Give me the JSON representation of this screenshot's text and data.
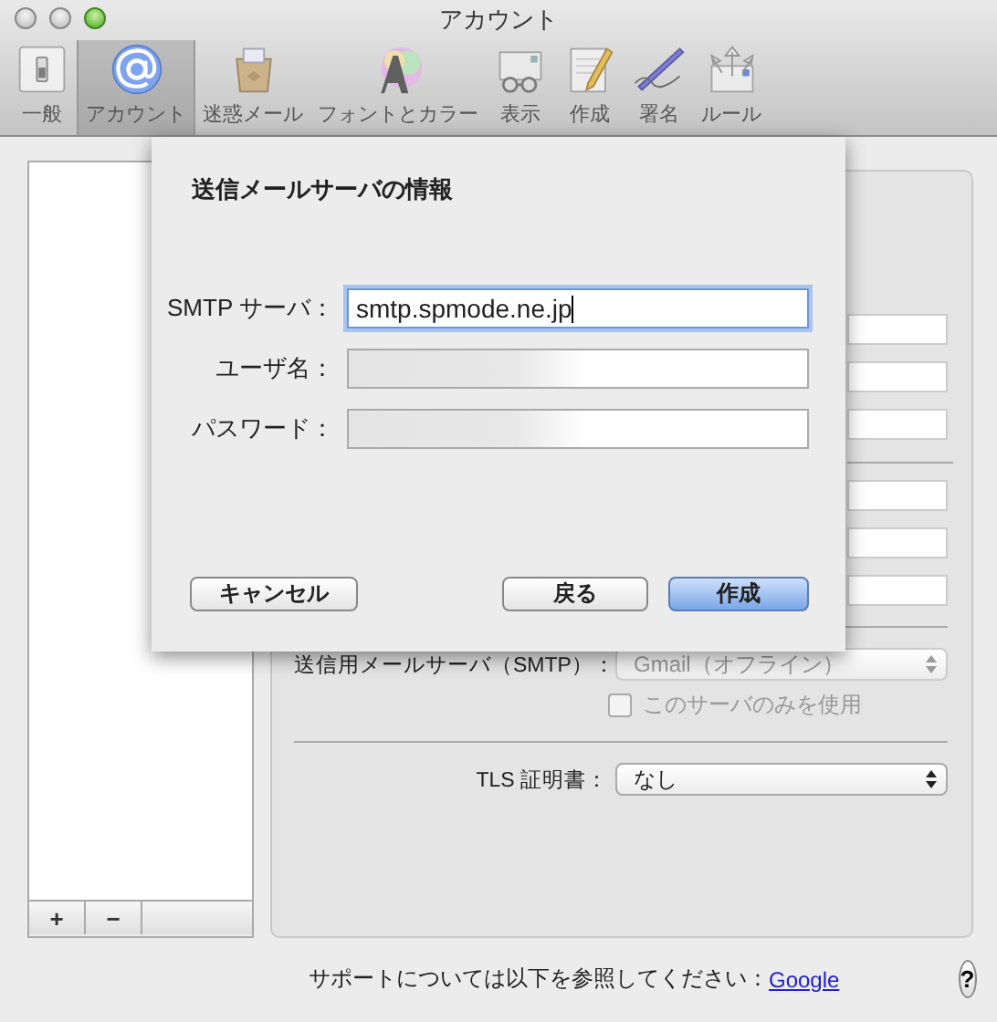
{
  "window": {
    "title": "アカウント"
  },
  "toolbar": [
    {
      "label": "一般",
      "selected": false
    },
    {
      "label": "アカウント",
      "selected": true
    },
    {
      "label": "迷惑メール",
      "selected": false
    },
    {
      "label": "フォントとカラー",
      "selected": false
    },
    {
      "label": "表示",
      "selected": false
    },
    {
      "label": "作成",
      "selected": false
    },
    {
      "label": "署名",
      "selected": false
    },
    {
      "label": "ルール",
      "selected": false
    }
  ],
  "accounts_list": {
    "add_button": "+",
    "remove_button": "−"
  },
  "account_panel": {
    "smtp_label": "送信用メールサーバ（SMTP）：",
    "smtp_popup": {
      "value": "Gmail（オフライン）",
      "disabled": true
    },
    "only_this_server": {
      "label": "このサーバのみを使用",
      "checked": false,
      "disabled": true
    },
    "tls_label": "TLS 証明書：",
    "tls_popup": {
      "value": "なし",
      "disabled": false
    }
  },
  "sheet": {
    "title": "送信メールサーバの情報",
    "fields": [
      {
        "label": "SMTP サーバ：",
        "value": "smtp.spmode.ne.jp",
        "focused": true,
        "blurred": false
      },
      {
        "label": "ユーザ名：",
        "focused": false,
        "blurred": true
      },
      {
        "label": "パスワード：",
        "focused": false,
        "blurred": true
      }
    ],
    "buttons": [
      {
        "label": "キャンセル",
        "kind": "normal"
      },
      {
        "label": "戻る",
        "kind": "normal"
      },
      {
        "label": "作成",
        "kind": "default"
      }
    ]
  },
  "footer": {
    "text": "サポートについては以下を参照してください：",
    "link": "Google",
    "help": "?"
  }
}
